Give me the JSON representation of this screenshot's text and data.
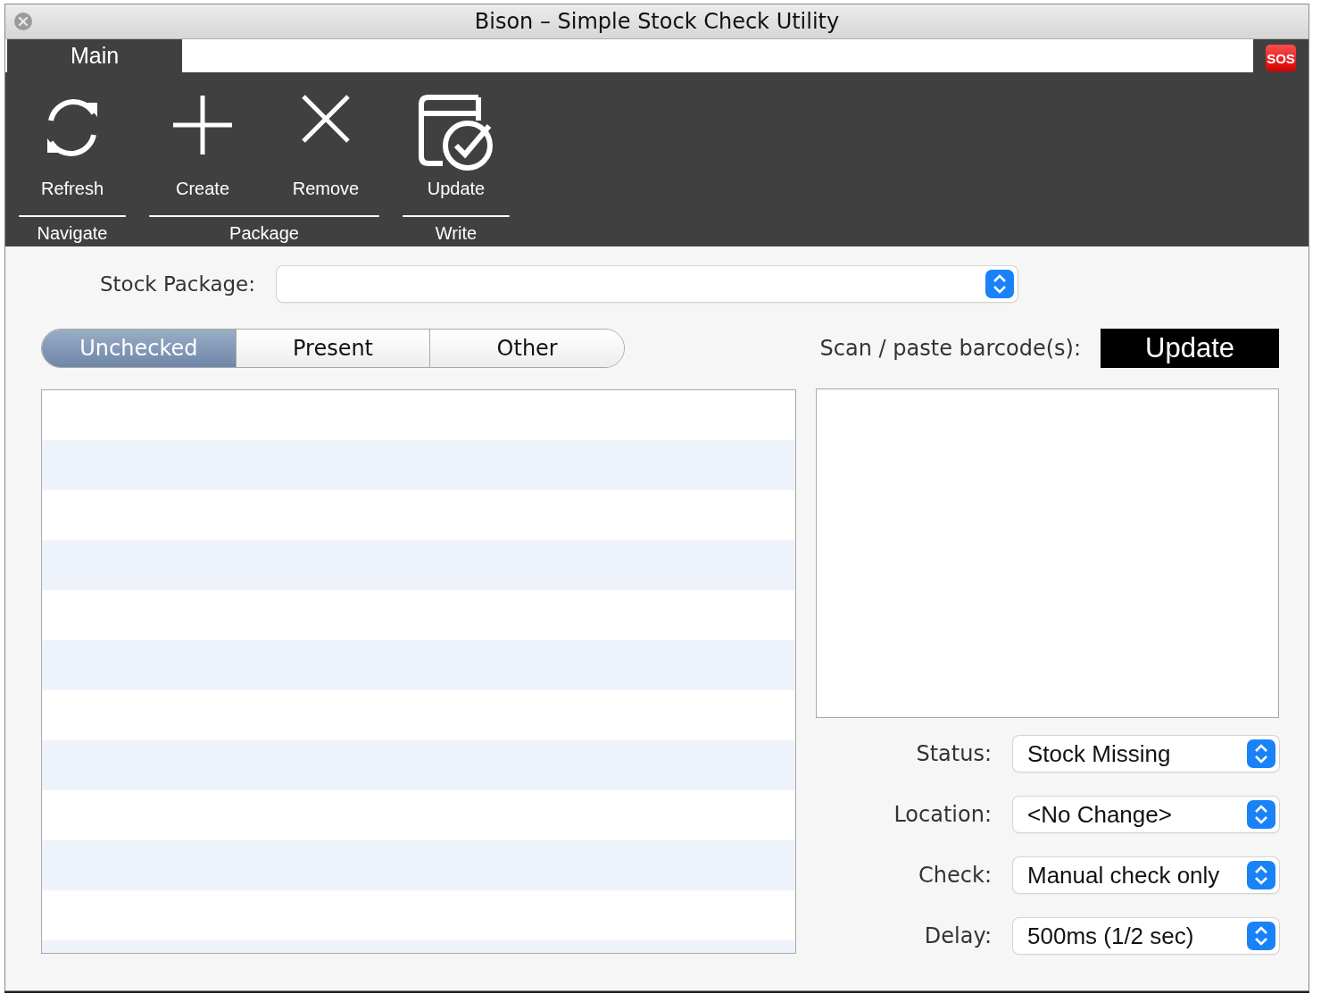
{
  "window": {
    "title": "Bison – Simple Stock Check Utility"
  },
  "tabs": [
    {
      "label": "Main",
      "selected": true
    }
  ],
  "sos_button": {
    "label": "SOS"
  },
  "ribbon": {
    "groups": [
      {
        "label": "Navigate",
        "buttons": [
          {
            "label": "Refresh",
            "kind": "refresh"
          }
        ]
      },
      {
        "label": "Package",
        "buttons": [
          {
            "label": "Create",
            "kind": "plus"
          },
          {
            "label": "Remove",
            "kind": "cross"
          }
        ]
      },
      {
        "label": "Write",
        "buttons": [
          {
            "label": "Update",
            "kind": "update"
          }
        ]
      }
    ]
  },
  "stock_package": {
    "label": "Stock Package:"
  },
  "filter_tabs": [
    {
      "label": "Unchecked",
      "selected": true
    },
    {
      "label": "Present",
      "selected": false
    },
    {
      "label": "Other",
      "selected": false
    }
  ],
  "scan": {
    "label": "Scan / paste barcode(s):",
    "button": "Update"
  },
  "options": [
    {
      "label": "Status:",
      "value": "Stock Missing"
    },
    {
      "label": "Location:",
      "value": "<No Change>"
    },
    {
      "label": "Check:",
      "value": "Manual check only"
    },
    {
      "label": "Delay:",
      "value": "500ms (1/2 sec)"
    }
  ]
}
